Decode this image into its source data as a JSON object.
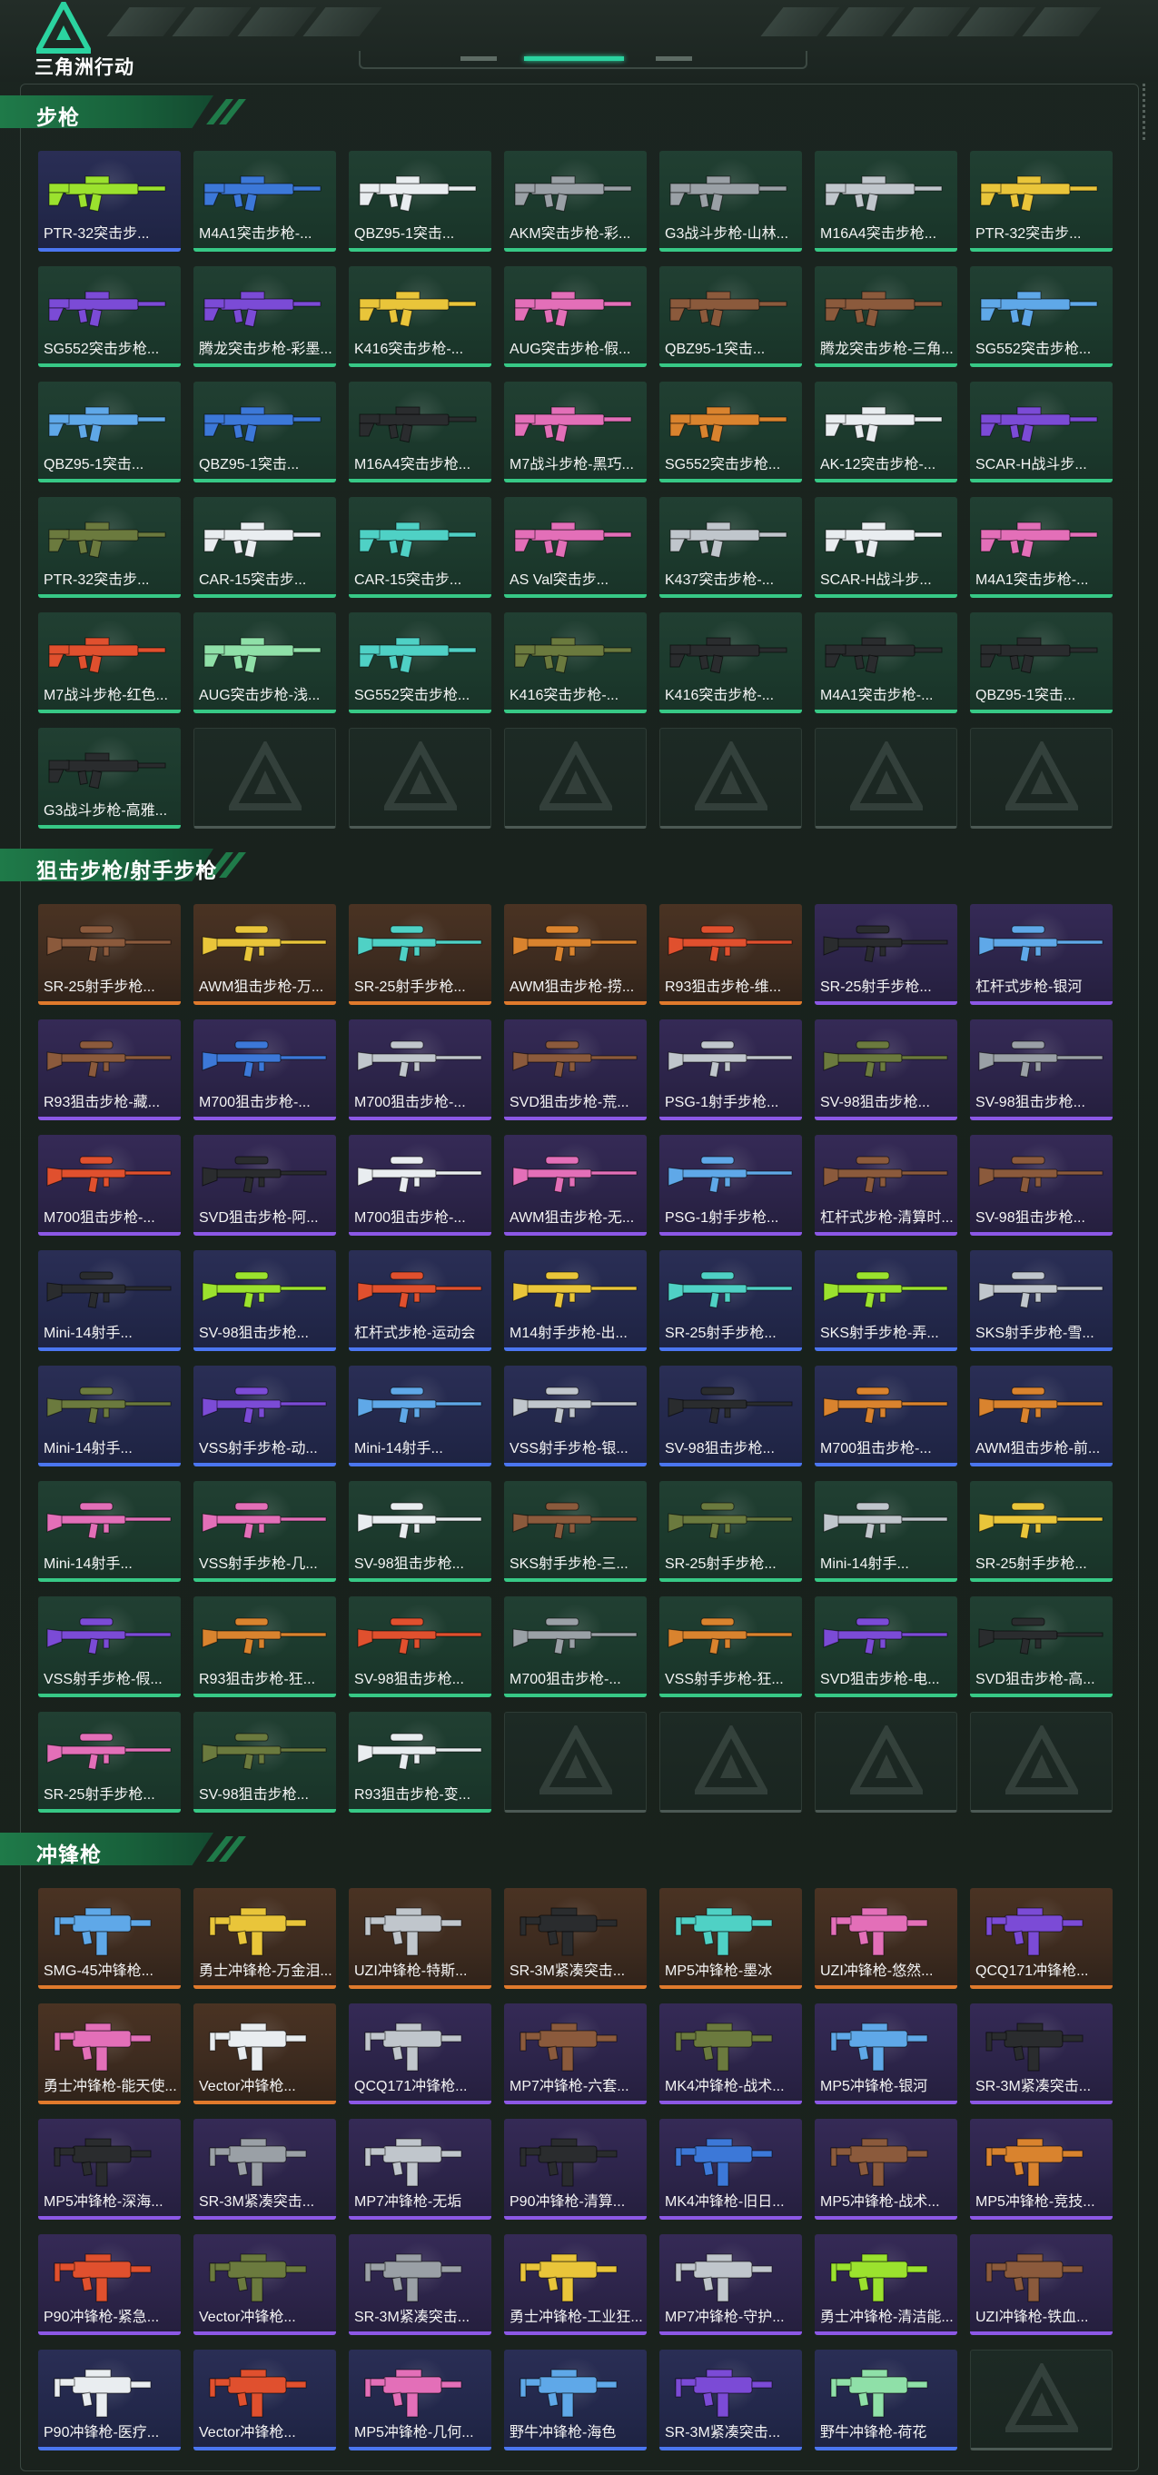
{
  "header": {
    "brand": "三角洲行动"
  },
  "colors": {
    "accent": "#2bd3a0",
    "rarity": {
      "g": "#37c986",
      "b": "#4b76f0",
      "p": "#8c58e6",
      "o": "#e07a2c"
    },
    "guns": {
      "g": "#9be22e",
      "b": "#3c78d8",
      "w": "#e9edf0",
      "y": "#e9c53a",
      "p": "#e36fb8",
      "k": "#2a2c2e",
      "r": "#e0502e",
      "t": "#4fd1c5",
      "v": "#7b4bd6",
      "m": "#9aa0a6",
      "o": "#d9832e",
      "c": "#8b5a3c",
      "s": "#c0c6cc",
      "n": "#6b7a3e",
      "u": "#5fa8e8",
      "q": "#8fe0a8"
    }
  },
  "sections": [
    {
      "title": "步枪",
      "items": [
        {
          "label": "PTR-32突击步...",
          "rarity": "b",
          "color": "g"
        },
        {
          "label": "M4A1突击步枪-...",
          "rarity": "g",
          "color": "b"
        },
        {
          "label": "QBZ95-1突击...",
          "rarity": "g",
          "color": "w"
        },
        {
          "label": "AKM突击步枪-彩...",
          "rarity": "g",
          "color": "m"
        },
        {
          "label": "G3战斗步枪-山林...",
          "rarity": "g",
          "color": "m"
        },
        {
          "label": "M16A4突击步枪...",
          "rarity": "g",
          "color": "s"
        },
        {
          "label": "PTR-32突击步...",
          "rarity": "g",
          "color": "y"
        },
        {
          "label": "SG552突击步枪...",
          "rarity": "g",
          "color": "v"
        },
        {
          "label": "腾龙突击步枪-彩墨...",
          "rarity": "g",
          "color": "v"
        },
        {
          "label": "K416突击步枪-...",
          "rarity": "g",
          "color": "y"
        },
        {
          "label": "AUG突击步枪-假...",
          "rarity": "g",
          "color": "p"
        },
        {
          "label": "QBZ95-1突击...",
          "rarity": "g",
          "color": "c"
        },
        {
          "label": "腾龙突击步枪-三角...",
          "rarity": "g",
          "color": "c"
        },
        {
          "label": "SG552突击步枪...",
          "rarity": "g",
          "color": "u"
        },
        {
          "label": "QBZ95-1突击...",
          "rarity": "g",
          "color": "u"
        },
        {
          "label": "QBZ95-1突击...",
          "rarity": "g",
          "color": "b"
        },
        {
          "label": "M16A4突击步枪...",
          "rarity": "g",
          "color": "k"
        },
        {
          "label": "M7战斗步枪-黑巧...",
          "rarity": "g",
          "color": "p"
        },
        {
          "label": "SG552突击步枪...",
          "rarity": "g",
          "color": "o"
        },
        {
          "label": "AK-12突击步枪-...",
          "rarity": "g",
          "color": "w"
        },
        {
          "label": "SCAR-H战斗步...",
          "rarity": "g",
          "color": "v"
        },
        {
          "label": "PTR-32突击步...",
          "rarity": "g",
          "color": "n"
        },
        {
          "label": "CAR-15突击步...",
          "rarity": "g",
          "color": "w"
        },
        {
          "label": "CAR-15突击步...",
          "rarity": "g",
          "color": "t"
        },
        {
          "label": "AS Val突击步...",
          "rarity": "g",
          "color": "p"
        },
        {
          "label": "K437突击步枪-...",
          "rarity": "g",
          "color": "s"
        },
        {
          "label": "SCAR-H战斗步...",
          "rarity": "g",
          "color": "w"
        },
        {
          "label": "M4A1突击步枪-...",
          "rarity": "g",
          "color": "p"
        },
        {
          "label": "M7战斗步枪-红色...",
          "rarity": "g",
          "color": "r"
        },
        {
          "label": "AUG突击步枪-浅...",
          "rarity": "g",
          "color": "q"
        },
        {
          "label": "SG552突击步枪...",
          "rarity": "g",
          "color": "t"
        },
        {
          "label": "K416突击步枪-...",
          "rarity": "g",
          "color": "n"
        },
        {
          "label": "K416突击步枪-...",
          "rarity": "g",
          "color": "k"
        },
        {
          "label": "M4A1突击步枪-...",
          "rarity": "g",
          "color": "k"
        },
        {
          "label": "QBZ95-1突击...",
          "rarity": "g",
          "color": "k"
        },
        {
          "label": "G3战斗步枪-高雅...",
          "rarity": "g",
          "color": "k"
        },
        {
          "empty": true
        },
        {
          "empty": true
        },
        {
          "empty": true
        },
        {
          "empty": true
        },
        {
          "empty": true
        },
        {
          "empty": true
        }
      ]
    },
    {
      "title": "狙击步枪/射手步枪",
      "items": [
        {
          "label": "SR-25射手步枪...",
          "rarity": "o",
          "color": "c"
        },
        {
          "label": "AWM狙击步枪-万...",
          "rarity": "o",
          "color": "y"
        },
        {
          "label": "SR-25射手步枪...",
          "rarity": "o",
          "color": "t"
        },
        {
          "label": "AWM狙击步枪-捞...",
          "rarity": "o",
          "color": "o"
        },
        {
          "label": "R93狙击步枪-维...",
          "rarity": "o",
          "color": "r"
        },
        {
          "label": "SR-25射手步枪...",
          "rarity": "p",
          "color": "k"
        },
        {
          "label": "杠杆式步枪-银河",
          "rarity": "p",
          "color": "u"
        },
        {
          "label": "R93狙击步枪-藏...",
          "rarity": "p",
          "color": "c"
        },
        {
          "label": "M700狙击步枪-...",
          "rarity": "p",
          "color": "b"
        },
        {
          "label": "M700狙击步枪-...",
          "rarity": "p",
          "color": "s"
        },
        {
          "label": "SVD狙击步枪-荒...",
          "rarity": "p",
          "color": "c"
        },
        {
          "label": "PSG-1射手步枪...",
          "rarity": "p",
          "color": "s"
        },
        {
          "label": "SV-98狙击步枪...",
          "rarity": "p",
          "color": "n"
        },
        {
          "label": "SV-98狙击步枪...",
          "rarity": "p",
          "color": "m"
        },
        {
          "label": "M700狙击步枪-...",
          "rarity": "p",
          "color": "r"
        },
        {
          "label": "SVD狙击步枪-阿...",
          "rarity": "p",
          "color": "k"
        },
        {
          "label": "M700狙击步枪-...",
          "rarity": "p",
          "color": "w"
        },
        {
          "label": "AWM狙击步枪-无...",
          "rarity": "p",
          "color": "p"
        },
        {
          "label": "PSG-1射手步枪...",
          "rarity": "p",
          "color": "u"
        },
        {
          "label": "杠杆式步枪-清算时...",
          "rarity": "p",
          "color": "c"
        },
        {
          "label": "SV-98狙击步枪...",
          "rarity": "p",
          "color": "c"
        },
        {
          "label": "Mini-14射手...",
          "rarity": "b",
          "color": "k"
        },
        {
          "label": "SV-98狙击步枪...",
          "rarity": "b",
          "color": "g"
        },
        {
          "label": "杠杆式步枪-运动会",
          "rarity": "b",
          "color": "r"
        },
        {
          "label": "M14射手步枪-出...",
          "rarity": "b",
          "color": "y"
        },
        {
          "label": "SR-25射手步枪...",
          "rarity": "b",
          "color": "t"
        },
        {
          "label": "SKS射手步枪-弄...",
          "rarity": "b",
          "color": "g"
        },
        {
          "label": "SKS射手步枪-雪...",
          "rarity": "b",
          "color": "s"
        },
        {
          "label": "Mini-14射手...",
          "rarity": "b",
          "color": "n"
        },
        {
          "label": "VSS射手步枪-动...",
          "rarity": "b",
          "color": "v"
        },
        {
          "label": "Mini-14射手...",
          "rarity": "b",
          "color": "u"
        },
        {
          "label": "VSS射手步枪-银...",
          "rarity": "b",
          "color": "s"
        },
        {
          "label": "SV-98狙击步枪...",
          "rarity": "b",
          "color": "k"
        },
        {
          "label": "M700狙击步枪-...",
          "rarity": "b",
          "color": "o"
        },
        {
          "label": "AWM狙击步枪-前...",
          "rarity": "b",
          "color": "o"
        },
        {
          "label": "Mini-14射手...",
          "rarity": "g",
          "color": "p"
        },
        {
          "label": "VSS射手步枪-几...",
          "rarity": "g",
          "color": "p"
        },
        {
          "label": "SV-98狙击步枪...",
          "rarity": "g",
          "color": "w"
        },
        {
          "label": "SKS射手步枪-三...",
          "rarity": "g",
          "color": "c"
        },
        {
          "label": "SR-25射手步枪...",
          "rarity": "g",
          "color": "n"
        },
        {
          "label": "Mini-14射手...",
          "rarity": "g",
          "color": "s"
        },
        {
          "label": "SR-25射手步枪...",
          "rarity": "g",
          "color": "y"
        },
        {
          "label": "VSS射手步枪-假...",
          "rarity": "g",
          "color": "v"
        },
        {
          "label": "R93狙击步枪-狂...",
          "rarity": "g",
          "color": "o"
        },
        {
          "label": "SV-98狙击步枪...",
          "rarity": "g",
          "color": "r"
        },
        {
          "label": "M700狙击步枪-...",
          "rarity": "g",
          "color": "m"
        },
        {
          "label": "VSS射手步枪-狂...",
          "rarity": "g",
          "color": "o"
        },
        {
          "label": "SVD狙击步枪-电...",
          "rarity": "g",
          "color": "v"
        },
        {
          "label": "SVD狙击步枪-高...",
          "rarity": "g",
          "color": "k"
        },
        {
          "label": "SR-25射手步枪...",
          "rarity": "g",
          "color": "p"
        },
        {
          "label": "SV-98狙击步枪...",
          "rarity": "g",
          "color": "n"
        },
        {
          "label": "R93狙击步枪-变...",
          "rarity": "g",
          "color": "w"
        },
        {
          "empty": true
        },
        {
          "empty": true
        },
        {
          "empty": true
        },
        {
          "empty": true
        }
      ]
    },
    {
      "title": "冲锋枪",
      "items": [
        {
          "label": "SMG-45冲锋枪...",
          "rarity": "o",
          "color": "u"
        },
        {
          "label": "勇士冲锋枪-万金泪...",
          "rarity": "o",
          "color": "y"
        },
        {
          "label": "UZI冲锋枪-特斯...",
          "rarity": "o",
          "color": "s"
        },
        {
          "label": "SR-3M紧凑突击...",
          "rarity": "o",
          "color": "k"
        },
        {
          "label": "MP5冲锋枪-墨冰",
          "rarity": "o",
          "color": "t"
        },
        {
          "label": "UZI冲锋枪-悠然...",
          "rarity": "o",
          "color": "p"
        },
        {
          "label": "QCQ171冲锋枪...",
          "rarity": "o",
          "color": "v"
        },
        {
          "label": "勇士冲锋枪-能天使...",
          "rarity": "o",
          "color": "p"
        },
        {
          "label": "Vector冲锋枪...",
          "rarity": "o",
          "color": "w"
        },
        {
          "label": "QCQ171冲锋枪...",
          "rarity": "p",
          "color": "s"
        },
        {
          "label": "MP7冲锋枪-六套...",
          "rarity": "p",
          "color": "c"
        },
        {
          "label": "MK4冲锋枪-战术...",
          "rarity": "p",
          "color": "n"
        },
        {
          "label": "MP5冲锋枪-银河",
          "rarity": "p",
          "color": "u"
        },
        {
          "label": "SR-3M紧凑突击...",
          "rarity": "p",
          "color": "k"
        },
        {
          "label": "MP5冲锋枪-深海...",
          "rarity": "p",
          "color": "k"
        },
        {
          "label": "SR-3M紧凑突击...",
          "rarity": "p",
          "color": "m"
        },
        {
          "label": "MP7冲锋枪-无垢",
          "rarity": "p",
          "color": "s"
        },
        {
          "label": "P90冲锋枪-清算...",
          "rarity": "p",
          "color": "k"
        },
        {
          "label": "MK4冲锋枪-旧日...",
          "rarity": "p",
          "color": "b"
        },
        {
          "label": "MP5冲锋枪-战术...",
          "rarity": "p",
          "color": "c"
        },
        {
          "label": "MP5冲锋枪-竞技...",
          "rarity": "p",
          "color": "o"
        },
        {
          "label": "P90冲锋枪-紧急...",
          "rarity": "p",
          "color": "r"
        },
        {
          "label": "Vector冲锋枪...",
          "rarity": "p",
          "color": "n"
        },
        {
          "label": "SR-3M紧凑突击...",
          "rarity": "p",
          "color": "m"
        },
        {
          "label": "勇士冲锋枪-工业狂...",
          "rarity": "p",
          "color": "y"
        },
        {
          "label": "MP7冲锋枪-守护...",
          "rarity": "p",
          "color": "s"
        },
        {
          "label": "勇士冲锋枪-清洁能...",
          "rarity": "p",
          "color": "g"
        },
        {
          "label": "UZI冲锋枪-铁血...",
          "rarity": "p",
          "color": "c"
        },
        {
          "label": "P90冲锋枪-医疗...",
          "rarity": "b",
          "color": "w"
        },
        {
          "label": "Vector冲锋枪...",
          "rarity": "b",
          "color": "r"
        },
        {
          "label": "MP5冲锋枪-几何...",
          "rarity": "b",
          "color": "p"
        },
        {
          "label": "野牛冲锋枪-海色",
          "rarity": "b",
          "color": "u"
        },
        {
          "label": "SR-3M紧凑突击...",
          "rarity": "b",
          "color": "v"
        },
        {
          "label": "野牛冲锋枪-荷花",
          "rarity": "b",
          "color": "q"
        },
        {
          "empty": true
        }
      ]
    }
  ]
}
